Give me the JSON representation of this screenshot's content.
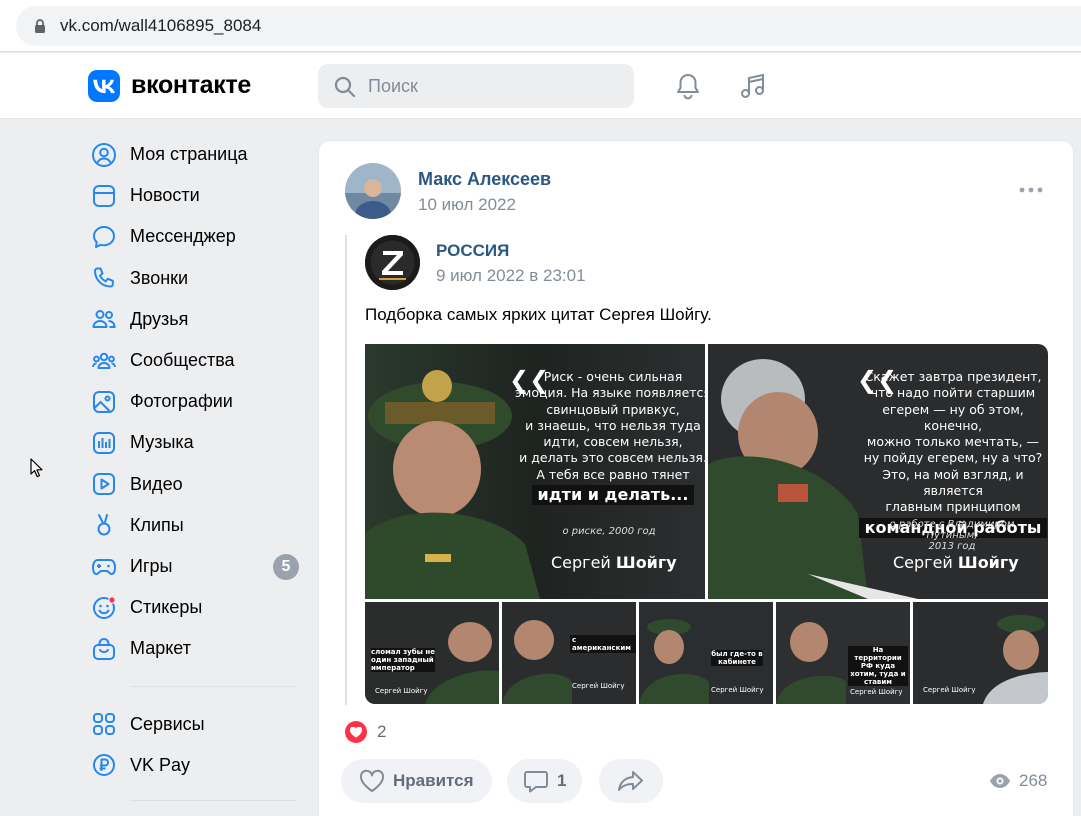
{
  "browser": {
    "url": "vk.com/wall4106895_8084"
  },
  "header": {
    "logo_text": "вконтакте",
    "search_placeholder": "Поиск"
  },
  "nav": {
    "items": [
      {
        "label": "Моя страница",
        "icon": "user-circle-icon"
      },
      {
        "label": "Новости",
        "icon": "news-icon"
      },
      {
        "label": "Мессенджер",
        "icon": "message-icon"
      },
      {
        "label": "Звонки",
        "icon": "phone-icon"
      },
      {
        "label": "Друзья",
        "icon": "friends-icon"
      },
      {
        "label": "Сообщества",
        "icon": "communities-icon"
      },
      {
        "label": "Фотографии",
        "icon": "photo-icon"
      },
      {
        "label": "Музыка",
        "icon": "music-icon"
      },
      {
        "label": "Видео",
        "icon": "video-icon"
      },
      {
        "label": "Клипы",
        "icon": "clips-icon"
      },
      {
        "label": "Игры",
        "icon": "games-icon",
        "badge": "5"
      },
      {
        "label": "Стикеры",
        "icon": "stickers-icon"
      },
      {
        "label": "Маркет",
        "icon": "market-icon"
      }
    ],
    "extra": [
      {
        "label": "Сервисы",
        "icon": "services-icon"
      },
      {
        "label": "VK Pay",
        "icon": "vkpay-icon"
      }
    ]
  },
  "post": {
    "author": "Макс Алексеев",
    "date": "10 июл 2022",
    "repost": {
      "name": "РОССИЯ",
      "date": "9 июл 2022 в 23:01",
      "text": "Подборка самых ярких цитат Сергея Шойгу."
    },
    "image1": {
      "quote_lines": [
        "Риск - очень сильная",
        "эмоция. На языке появляется",
        "свинцовый привкус,",
        "и знаешь, что нельзя туда",
        "идти, совсем нельзя,",
        "и делать это совсем нельзя.",
        "А тебя все равно тянет"
      ],
      "quote_strong": "идти и делать...",
      "source": "о риске, 2000 год",
      "sign_first": "Сергей",
      "sign_last": "Шойгу"
    },
    "image2": {
      "quote_lines": [
        "Скажет завтра президент,",
        "что надо пойти старшим",
        "егерем — ну об этом, конечно,",
        "можно только мечтать, —",
        "ну пойду егерем, ну а что?",
        "Это, на мой взгляд, и является",
        "главным принципом"
      ],
      "quote_strong": "командной работы",
      "source_lines": [
        "о работе с Владимиром Путиным,",
        "2013 год"
      ],
      "sign_first": "Сергей",
      "sign_last": "Шойгу"
    },
    "thumbs": [
      {
        "strong": "сломал зубы не один западный император",
        "sign": "Сергей Шойгу"
      },
      {
        "strong": "с американским",
        "sign": "Сергей Шойгу"
      },
      {
        "strong": "был где-то в кабинете",
        "sign": "Сергей Шойгу"
      },
      {
        "strong": "На территории РФ куда хотим, туда и ставим",
        "sign": "Сергей Шойгу"
      },
      {
        "strong": "",
        "sign": "Сергей Шойгу"
      }
    ],
    "likes_count": "2",
    "like_label": "Нравится",
    "comments_count": "1",
    "views": "268"
  },
  "colors": {
    "link": "#2a5885",
    "secondary": "#818c99",
    "accent": "#2688eb",
    "like": "#ff3347"
  }
}
